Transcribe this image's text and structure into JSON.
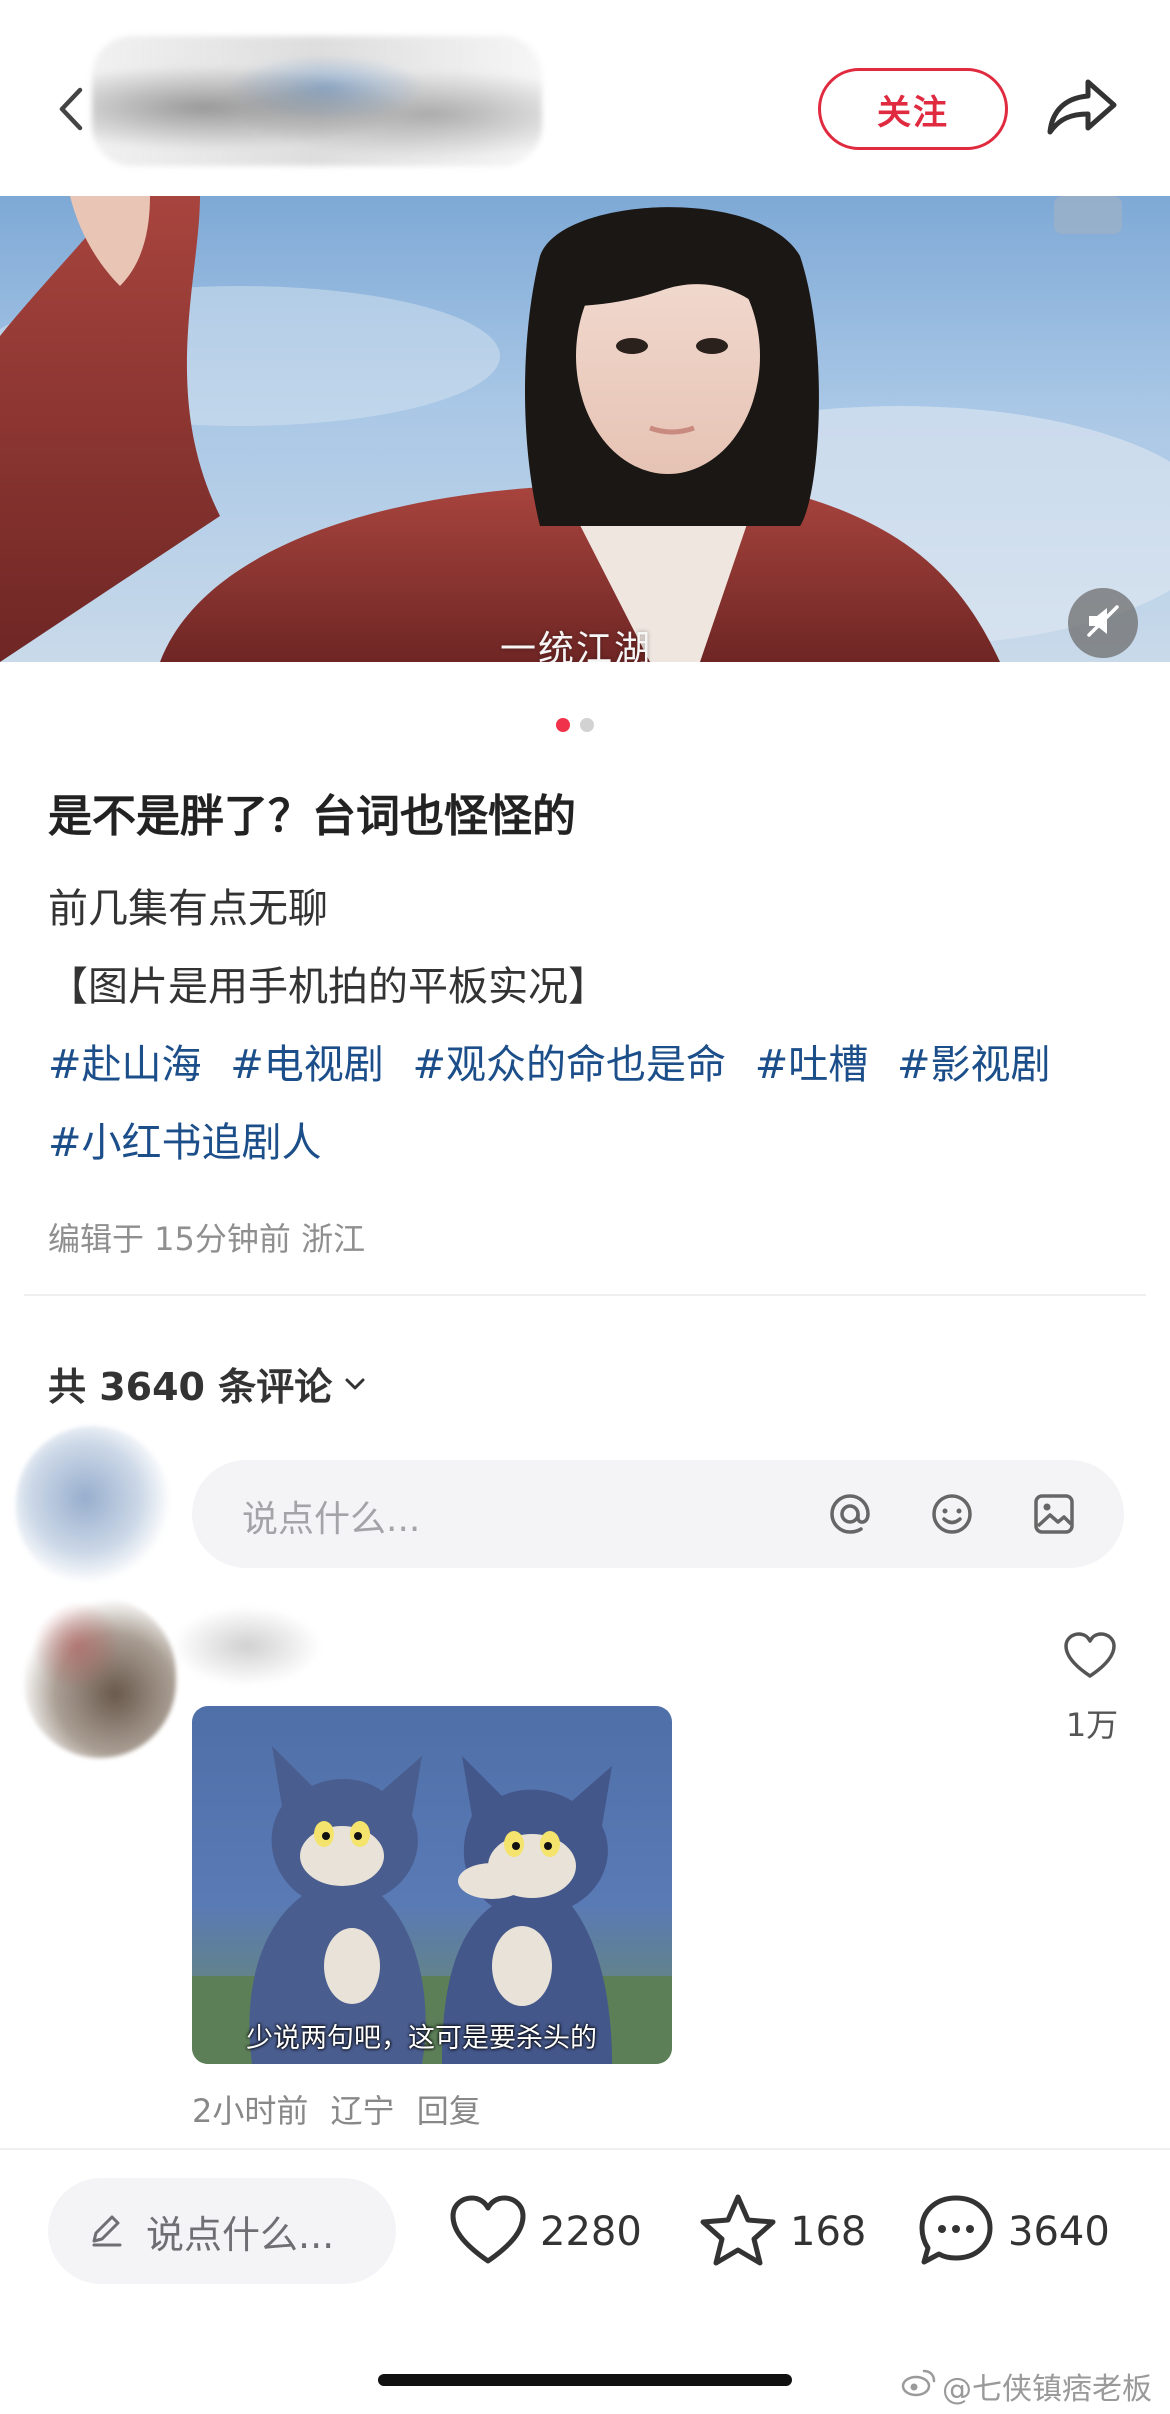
{
  "header": {
    "follow_label": "关注",
    "icons": {
      "back": "chevron-left-icon",
      "share": "share-arrow-icon"
    }
  },
  "hero": {
    "subtitle": "一统江湖",
    "page_indicator": {
      "total": 2,
      "active": 1
    },
    "icons": {
      "mute": "muted-speaker-icon"
    }
  },
  "post": {
    "title": "是不是胖了？台词也怪怪的",
    "body": [
      "前几集有点无聊",
      "【图片是用手机拍的平板实况】"
    ],
    "tags_line1": [
      "#赴山海",
      "#电视剧",
      "#观众的命也是命",
      "#吐槽",
      "#影视剧"
    ],
    "tags_line2": [
      "#小红书追剧人"
    ],
    "meta": "编辑于 15分钟前 浙江"
  },
  "comments": {
    "count_label": "共 3640 条评论",
    "input_placeholder": "说点什么...",
    "input_icons": [
      "at-icon",
      "emoji-icon",
      "image-icon"
    ],
    "first": {
      "like_count": "1万",
      "image_caption": "少说两句吧，这可是要杀头的",
      "time": "2小时前",
      "location": "辽宁",
      "reply_label": "回复"
    }
  },
  "bottom_bar": {
    "input_label": "说点什么...",
    "likes": "2280",
    "favorites": "168",
    "comments": "3640"
  },
  "watermark": "@七侠镇痞老板",
  "colors": {
    "accent": "#e02a3f",
    "tag": "#1c4f8a",
    "dot_active": "#f0324a"
  }
}
